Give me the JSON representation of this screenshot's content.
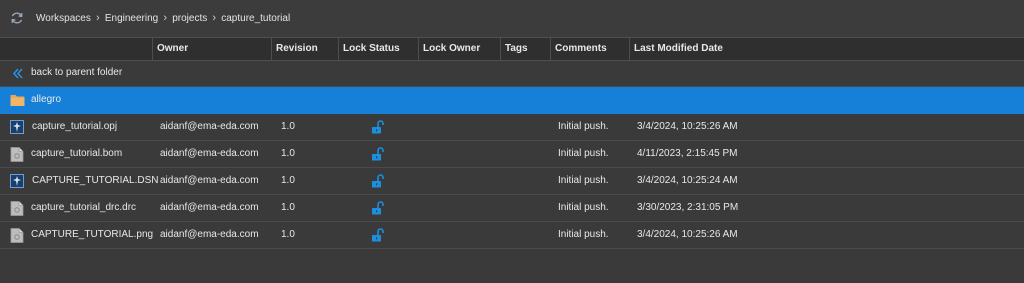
{
  "breadcrumb": [
    "Workspaces",
    "Engineering",
    "projects",
    "capture_tutorial"
  ],
  "columns": [
    "Owner",
    "Revision",
    "Lock Status",
    "Lock Owner",
    "Tags",
    "Comments",
    "Last Modified Date"
  ],
  "back_label": "back to parent folder",
  "folder": {
    "name": "allegro"
  },
  "files": [
    {
      "name": "capture_tutorial.opj",
      "owner": "aidanf@ema-eda.com",
      "revision": "1.0",
      "lock": "unlocked",
      "comments": "Initial push.",
      "modified": "3/4/2024, 10:25:26 AM",
      "icon": "capture-file-icon"
    },
    {
      "name": "capture_tutorial.bom",
      "owner": "aidanf@ema-eda.com",
      "revision": "1.0",
      "lock": "unlocked",
      "comments": "Initial push.",
      "modified": "4/11/2023, 2:15:45 PM",
      "icon": "generic-file-icon"
    },
    {
      "name": "CAPTURE_TUTORIAL.DSN",
      "owner": "aidanf@ema-eda.com",
      "revision": "1.0",
      "lock": "unlocked",
      "comments": "Initial push.",
      "modified": "3/4/2024, 10:25:24 AM",
      "icon": "capture-file-icon"
    },
    {
      "name": "capture_tutorial_drc.drc",
      "owner": "aidanf@ema-eda.com",
      "revision": "1.0",
      "lock": "unlocked",
      "comments": "Initial push.",
      "modified": "3/30/2023, 2:31:05 PM",
      "icon": "generic-file-icon"
    },
    {
      "name": "CAPTURE_TUTORIAL.png",
      "owner": "aidanf@ema-eda.com",
      "revision": "1.0",
      "lock": "unlocked",
      "comments": "Initial push.",
      "modified": "3/4/2024, 10:25:26 AM",
      "icon": "generic-file-icon"
    }
  ],
  "colors": {
    "selection": "#1680d8",
    "lock_icon": "#1a90e0",
    "folder": "#e8a857",
    "background": "#3a3a3a",
    "header": "#2f2f2f"
  }
}
